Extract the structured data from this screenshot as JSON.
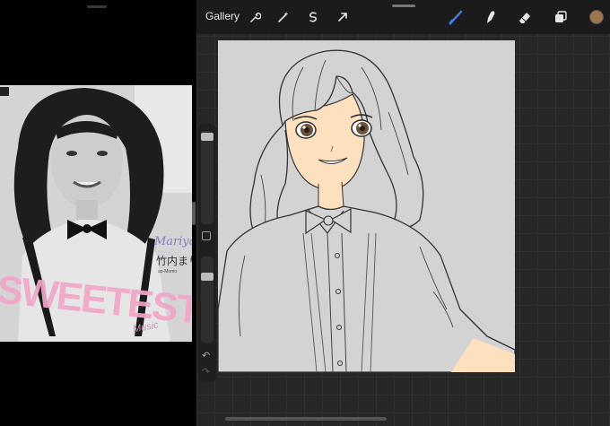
{
  "toolbar": {
    "gallery_label": "Gallery",
    "left_tools": [
      "wrench-icon",
      "magic-wand-icon",
      "selection-icon",
      "transform-arrow-icon"
    ],
    "right_tools": [
      "brush-icon",
      "smudge-icon",
      "eraser-icon",
      "layers-icon"
    ],
    "brush_color": "#3f7de0",
    "current_color": "#9b7650"
  },
  "sidebar": {
    "brush_size": 0.97,
    "opacity": 0.85
  },
  "reference": {
    "album_name": "Mariya",
    "artist_kanji": "竹内まりや",
    "title": "SWEETEST",
    "subtitle": "Music",
    "label_small": "ao-Momo"
  },
  "colors": {
    "app_bg": "#262626",
    "canvas_bg": "#d3d3d3",
    "skin": "#fde0bd"
  }
}
